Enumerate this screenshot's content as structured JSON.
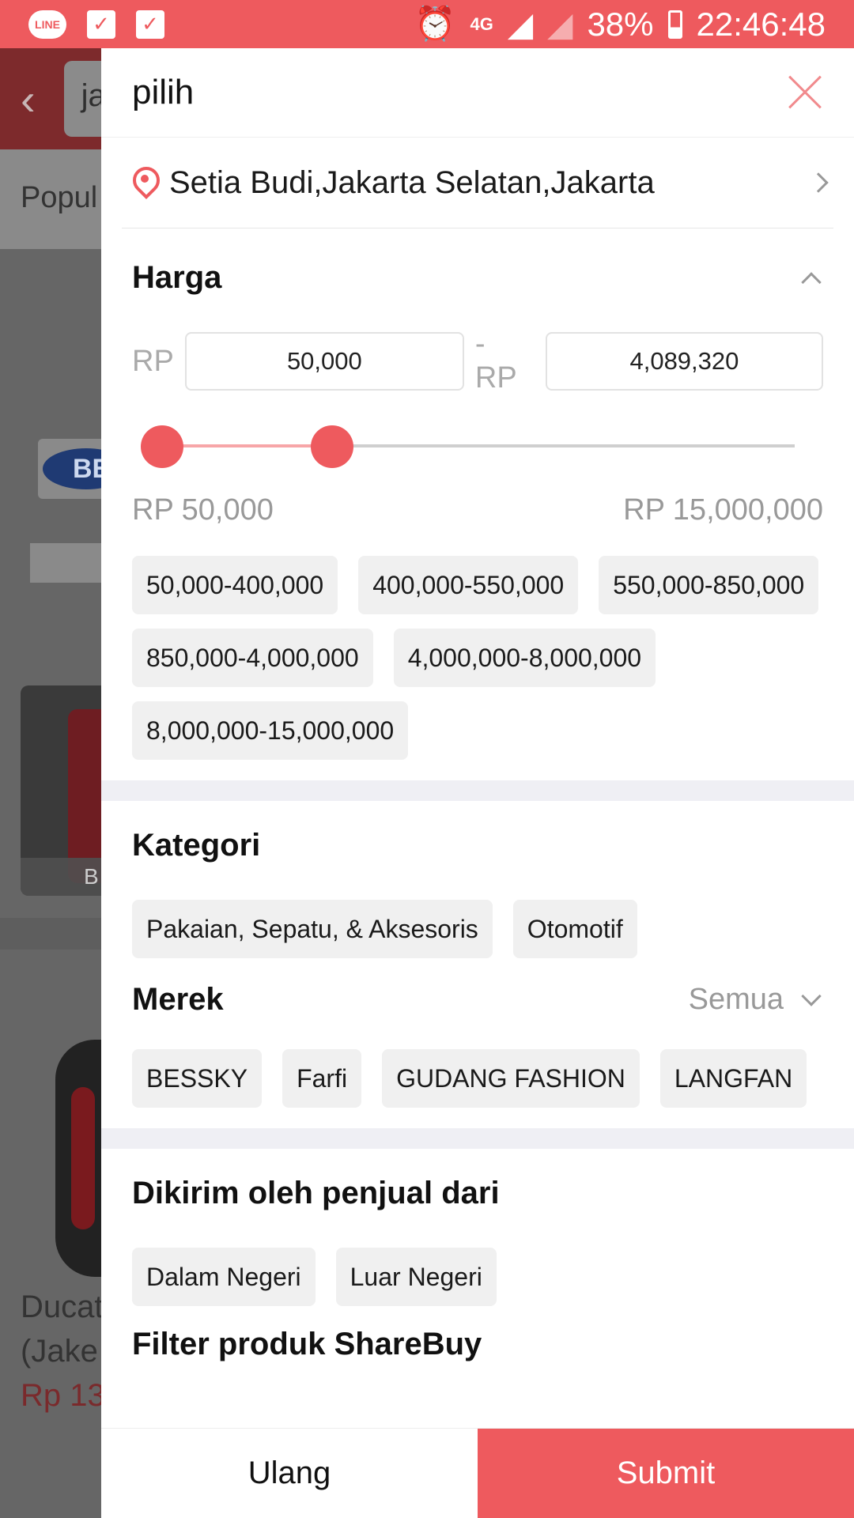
{
  "status_bar": {
    "line_label": "LINE",
    "network": "4G",
    "battery": "38%",
    "time": "22:46:48"
  },
  "background": {
    "search_text": "ja",
    "sort_label": "Popul",
    "brand_logo": "BE",
    "product_caption": "B",
    "product_title_line1": "Ducat",
    "product_title_line2": "(Jake",
    "product_price": "Rp 13"
  },
  "drawer": {
    "title": "pilih",
    "location": "Setia Budi,Jakarta Selatan,Jakarta",
    "price": {
      "title": "Harga",
      "currency": "RP",
      "currency_sep": "- RP",
      "min_value": "50,000",
      "max_value": "4,089,320",
      "range_min_label": "RP 50,000",
      "range_max_label": "RP 15,000,000",
      "slider_min_fraction": 0.0,
      "slider_max_fraction": 0.273,
      "ranges": [
        "50,000-400,000",
        "400,000-550,000",
        "550,000-850,000",
        "850,000-4,000,000",
        "4,000,000-8,000,000",
        "8,000,000-15,000,000"
      ]
    },
    "category": {
      "title": "Kategori",
      "items": [
        "Pakaian, Sepatu, & Aksesoris",
        "Otomotif"
      ]
    },
    "brand": {
      "title": "Merek",
      "all_label": "Semua",
      "items": [
        "BESSKY",
        "Farfi",
        "GUDANG FASHION",
        "LANGFAN"
      ]
    },
    "seller": {
      "title": "Dikirim oleh penjual dari",
      "items": [
        "Dalam Negeri",
        "Luar Negeri"
      ]
    },
    "sharebuy": {
      "title": "Filter produk ShareBuy"
    },
    "buttons": {
      "reset": "Ulang",
      "submit": "Submit"
    }
  },
  "colors": {
    "accent": "#ee5a5e",
    "chip_bg": "#f0f0f0",
    "overlay": "#666666"
  }
}
